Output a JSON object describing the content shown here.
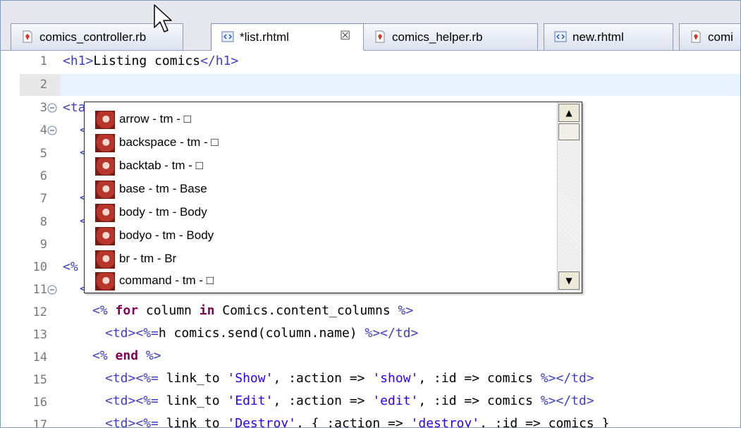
{
  "tabs": [
    {
      "label": "comics_controller.rb",
      "icon": "ruby-file-icon",
      "active": false
    },
    {
      "label": "*list.rhtml",
      "icon": "rhtml-file-icon",
      "active": true,
      "close": "☒"
    },
    {
      "label": "comics_helper.rb",
      "icon": "ruby-file-icon",
      "active": false
    },
    {
      "label": "new.rhtml",
      "icon": "rhtml-file-icon",
      "active": false
    },
    {
      "label": "comi",
      "icon": "ruby-file-icon",
      "active": false
    }
  ],
  "editor": {
    "line_numbers": [
      "1",
      "2",
      "3",
      "4",
      "5",
      "6",
      "7",
      "8",
      "9",
      "10",
      "11",
      "12",
      "13",
      "14",
      "15",
      "16",
      "17"
    ],
    "current_line": "2",
    "lines": {
      "l1": {
        "open": "<h1>",
        "text": "Listing comics",
        "close": "</h1>"
      },
      "l3": "<ta",
      "l10": "<%",
      "l12": {
        "a": "<% ",
        "kw": "for",
        " b": " column ",
        "kw2": "in",
        "c": " Comics.content_columns ",
        "d": "%>"
      },
      "l13": {
        "a": "<td>",
        "b": "<%=",
        "c": "h comics.send(column.name) ",
        "d": "%>",
        "e": "</td>"
      },
      "l14": {
        "a": "<% ",
        "kw": "end",
        " b": " %>"
      },
      "l15": {
        "a": "<td>",
        "b": "<%=",
        "c": " link_to ",
        "s1": "'Show'",
        "d": ", :action => ",
        "s2": "'show'",
        "e": ", :id => comics ",
        "f": "%>",
        "g": "</td>"
      },
      "l16": {
        "a": "<td>",
        "b": "<%=",
        "c": " link_to ",
        "s1": "'Edit'",
        "d": ", :action => ",
        "s2": "'edit'",
        "e": ", :id => comics ",
        "f": "%>",
        "g": "</td>"
      },
      "l17": {
        "a": "<td>",
        "b": "<%=",
        "c": " link_to ",
        "s1": "'Destroy'",
        "d": ", { :action => ",
        "s2": "'destroy'",
        "e": ", :id => comics }"
      }
    }
  },
  "autocomplete": {
    "items": [
      {
        "label": "arrow - tm - □"
      },
      {
        "label": "backspace - tm - □"
      },
      {
        "label": "backtab - tm - □"
      },
      {
        "label": "base - tm - Base"
      },
      {
        "label": "body - tm - Body"
      },
      {
        "label": "bodyo - tm - Body"
      },
      {
        "label": "br - tm - Br"
      },
      {
        "label": "command - tm - □"
      }
    ],
    "scroll_up": "▲",
    "scroll_down": "▼"
  },
  "colors": {
    "tag": "#3f3fbf",
    "keyword": "#7f0055",
    "string": "#2a00ff",
    "current_line": "#e8f2fe"
  }
}
